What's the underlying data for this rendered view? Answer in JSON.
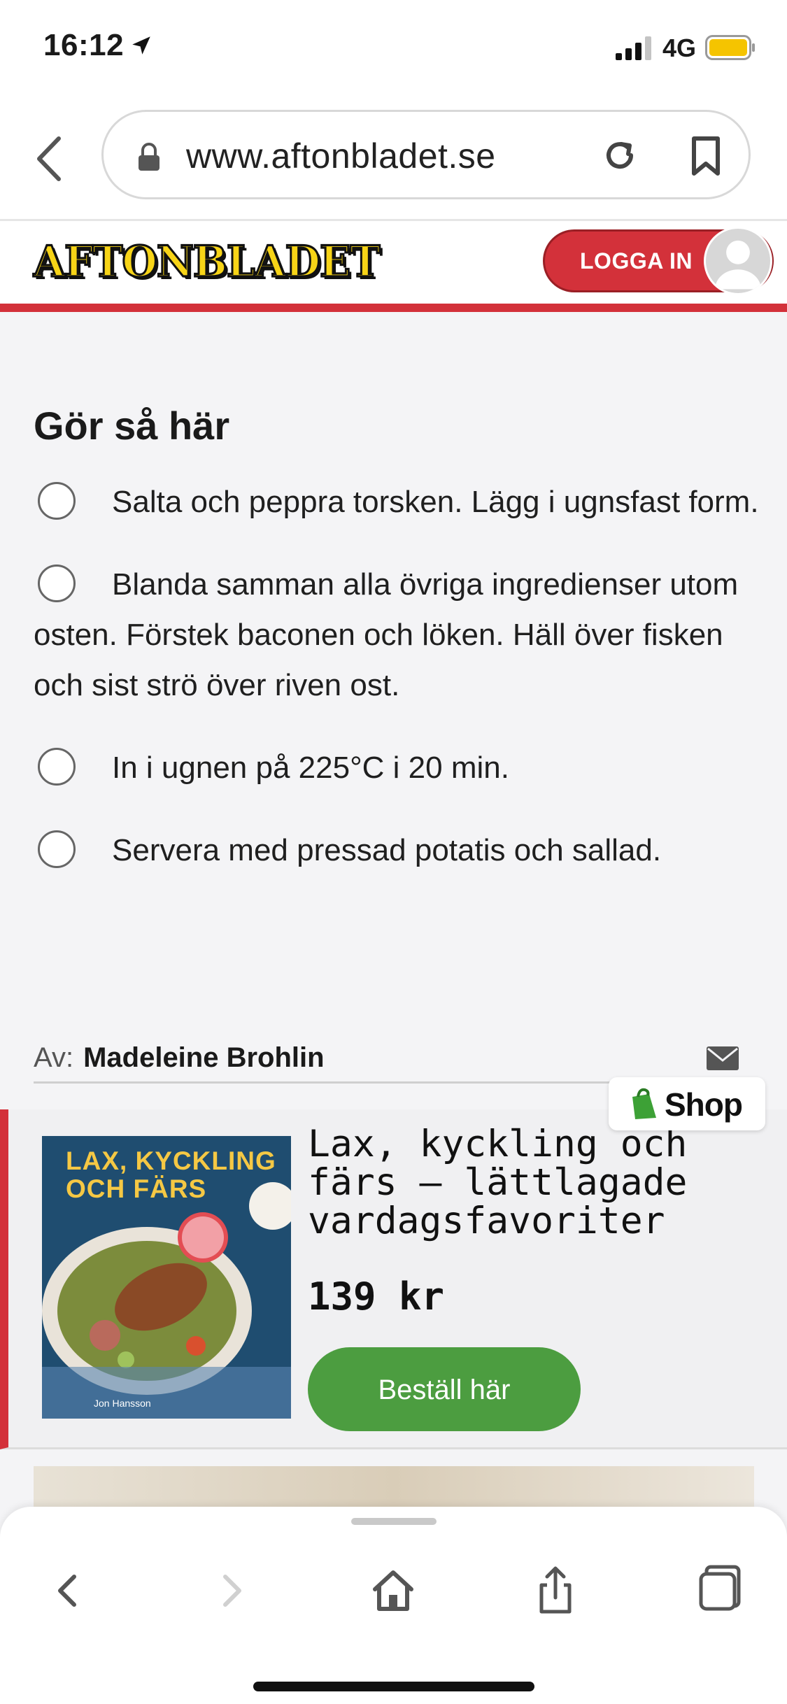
{
  "status_bar": {
    "time": "16:12",
    "network": "4G",
    "battery_color": "#f5c400"
  },
  "browser": {
    "url": "www.aftonbladet.se",
    "icons": [
      "back-chevron-icon",
      "lock-icon",
      "reload-icon",
      "bookmark-icon"
    ]
  },
  "site_header": {
    "logo": "AFTONBLADET",
    "login_label": "LOGGA IN",
    "accent": "#d3313a",
    "logo_color": "#f7d417"
  },
  "recipe": {
    "heading": "Gör så här",
    "steps": [
      {
        "text": "Salta och peppra torsken. Lägg i ugnsfast form."
      },
      {
        "text": "Blanda samman alla övriga ingredienser utom osten. Förstek baconen och löken. Häll över fisken och sist strö över riven ost."
      },
      {
        "text": "In i ugnen på 225°C i 20 min."
      },
      {
        "text": "Servera med pressad potatis och sallad."
      }
    ],
    "byline_label": "Av:",
    "author": "Madeleine Brohlin"
  },
  "product": {
    "shop_badge": "Shop",
    "cover_title": "LAX, KYCKLING OCH FÄRS",
    "cover_author": "Jon Hansson",
    "title": "Lax, kyckling och färs – lättlagade vardagsfavoriter",
    "price": "139 kr",
    "buy_label": "Beställ här",
    "button_color": "#4c9d40"
  },
  "toolbar": {
    "icons": [
      "back-icon",
      "forward-icon",
      "home-icon",
      "share-icon",
      "tabs-icon"
    ]
  }
}
